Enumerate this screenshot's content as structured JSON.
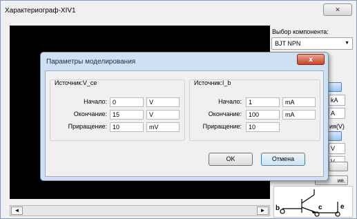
{
  "window": {
    "title": "Характериограф-XIV1",
    "close_icon": "✕"
  },
  "right_panel": {
    "component_label": "Выбор компонента:",
    "component_value": "BJT NPN",
    "partial": {
      "unit1": "kA",
      "unit2": "A",
      "text1": "ия(V)",
      "unit3": "V",
      "unit4": "V",
      "text2": "ие."
    }
  },
  "scrollbar": {
    "left_arrow": "◄",
    "right_arrow": "►"
  },
  "dialog": {
    "title": "Параметры моделирования",
    "close_icon": "x",
    "group_vce": {
      "title": "Источник:V_ce",
      "start_label": "Начало:",
      "start_value": "0",
      "start_unit": "V",
      "end_label": "Окончание:",
      "end_value": "15",
      "end_unit": "V",
      "step_label": "Приращение:",
      "step_value": "10",
      "step_unit": "mV"
    },
    "group_ib": {
      "title": "Источник:I_b",
      "start_label": "Начало:",
      "start_value": "1",
      "start_unit": "mA",
      "end_label": "Окончание:",
      "end_value": "100",
      "end_unit": "mA",
      "step_label": "Приращение:",
      "step_value": "10"
    },
    "ok_label": "OK",
    "cancel_label": "Отмена"
  },
  "symbol": {
    "b": "b",
    "c": "c",
    "e": "e"
  }
}
